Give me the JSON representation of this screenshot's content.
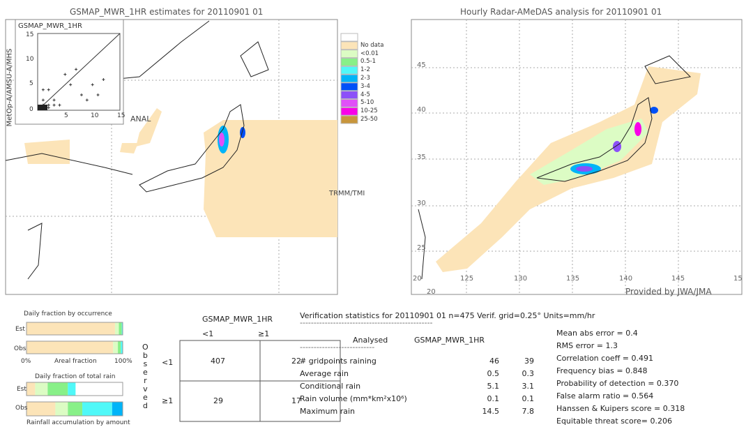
{
  "left_map": {
    "title": "GSMAP_MWR_1HR estimates for 20110901 01",
    "ylabel": "MetOp-A/AMSU-A/MHS",
    "inset_title": "GSMAP_MWR_1HR",
    "inset_ticks": [
      "0",
      "5",
      "10",
      "15"
    ],
    "label_anal": "ANAL",
    "label_trmm": "TRMM/TMI"
  },
  "right_map": {
    "title": "Hourly Radar-AMeDAS analysis for 20110901 01",
    "lat_ticks": [
      "45",
      "40",
      "35",
      "30",
      "25",
      "20"
    ],
    "lon_ticks": [
      "20",
      "125",
      "130",
      "135",
      "140",
      "145",
      "15"
    ],
    "lat_bottom": "20",
    "credit": "Provided by JWA/JMA"
  },
  "legend": {
    "items": [
      {
        "label": "",
        "color": "#ffffff"
      },
      {
        "label": "No data",
        "color": "#fce4b8"
      },
      {
        "label": "<0.01",
        "color": "#dcfcc4"
      },
      {
        "label": "0.5-1",
        "color": "#88f088"
      },
      {
        "label": "1-2",
        "color": "#50f8f8"
      },
      {
        "label": "2-3",
        "color": "#00b4f8"
      },
      {
        "label": "3-4",
        "color": "#0050f8"
      },
      {
        "label": "4-5",
        "color": "#8c50f8"
      },
      {
        "label": "5-10",
        "color": "#e050f8"
      },
      {
        "label": "10-25",
        "color": "#f800e8"
      },
      {
        "label": "25-50",
        "color": "#c8963c"
      }
    ]
  },
  "occurrence": {
    "title": "Daily fraction by occurrence",
    "est_label": "Est",
    "obs_label": "Obs",
    "axis_left": "0%",
    "axis_mid": "Areal fraction",
    "axis_right": "100%",
    "est": [
      {
        "f": 0.92,
        "color": "#fce4b8"
      },
      {
        "f": 0.04,
        "color": "#dcfcc4"
      },
      {
        "f": 0.03,
        "color": "#88f088"
      },
      {
        "f": 0.01,
        "color": "#50f8f8"
      }
    ],
    "obs": [
      {
        "f": 0.9,
        "color": "#fce4b8"
      },
      {
        "f": 0.05,
        "color": "#dcfcc4"
      },
      {
        "f": 0.03,
        "color": "#88f088"
      },
      {
        "f": 0.02,
        "color": "#50f8f8"
      }
    ]
  },
  "total_rain": {
    "title": "Daily fraction of total rain",
    "est_label": "Est",
    "obs_label": "Obs",
    "axis_label": "Rainfall accumulation by amount",
    "est": [
      {
        "f": 0.09,
        "color": "#fce4b8"
      },
      {
        "f": 0.13,
        "color": "#dcfcc4"
      },
      {
        "f": 0.21,
        "color": "#88f088"
      },
      {
        "f": 0.08,
        "color": "#50f8f8"
      }
    ],
    "obs": [
      {
        "f": 0.3,
        "color": "#fce4b8"
      },
      {
        "f": 0.13,
        "color": "#dcfcc4"
      },
      {
        "f": 0.15,
        "color": "#88f088"
      },
      {
        "f": 0.31,
        "color": "#50f8f8"
      },
      {
        "f": 0.11,
        "color": "#00b4f8"
      }
    ]
  },
  "contingency": {
    "title": "GSMAP_MWR_1HR",
    "col_lt": "<1",
    "col_ge": "≥1",
    "row_lt": "<1",
    "row_ge": "≥1",
    "observed": [
      "O",
      "b",
      "s",
      "e",
      "r",
      "v",
      "e",
      "d"
    ],
    "cells": [
      "407",
      "22",
      "29",
      "17"
    ]
  },
  "stats": {
    "header": "Verification statistics for 20110901 01   n=475   Verif. grid=0.25°   Units=mm/hr",
    "dashes": "------------------------------------------------",
    "col_analysed": "Analysed",
    "col_est": "GSMAP_MWR_1HR",
    "dashes2": "---------------------------",
    "rows": [
      {
        "label": "# gridpoints raining",
        "a": "46",
        "b": "39"
      },
      {
        "label": "Average rain",
        "a": "0.5",
        "b": "0.3"
      },
      {
        "label": "Conditional rain",
        "a": "5.1",
        "b": "3.1"
      },
      {
        "label": "Rain volume (mm*km²x10⁶)",
        "a": "0.1",
        "b": "0.1"
      },
      {
        "label": "Maximum rain",
        "a": "14.5",
        "b": "7.8"
      }
    ],
    "scores": [
      "Mean abs error = 0.4",
      "RMS error = 1.3",
      "Correlation coeff = 0.491",
      "Frequency bias = 0.848",
      "Probability of detection = 0.370",
      "False alarm ratio = 0.564",
      "Hanssen & Kuipers score = 0.318",
      "Equitable threat score= 0.206"
    ]
  },
  "chart_data": {
    "type": "table",
    "contingency": {
      "rows": [
        "Observed <1",
        "Observed ≥1"
      ],
      "cols": [
        "GSMAP <1",
        "GSMAP ≥1"
      ],
      "values": [
        [
          407,
          22
        ],
        [
          29,
          17
        ]
      ]
    },
    "scatter_axes": {
      "xlim": [
        0,
        15
      ],
      "ylim": [
        0,
        15
      ]
    }
  }
}
